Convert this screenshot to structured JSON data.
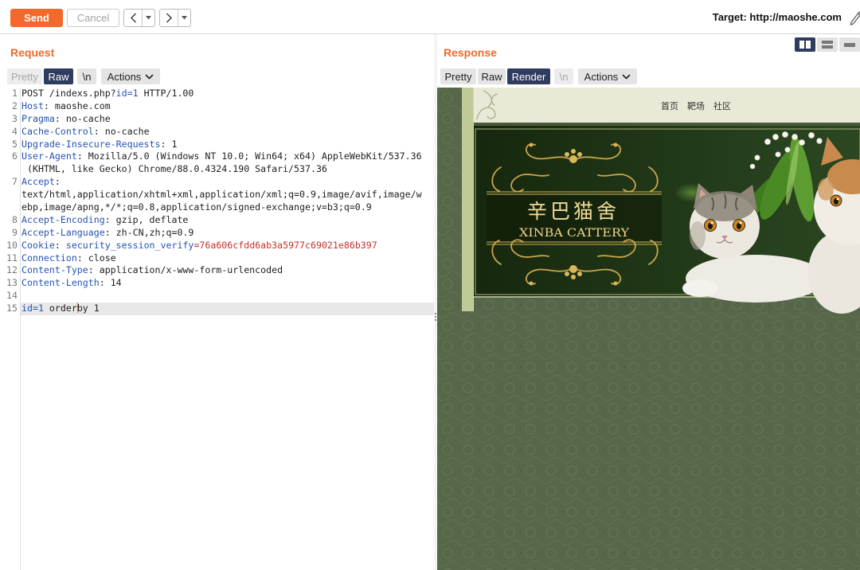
{
  "colors": {
    "accent": "#f2692b",
    "selected_tab": "#2f3b5f",
    "header_name": "#2653b3",
    "cookie_value": "#c4312a",
    "caret": "#e8732c",
    "render_bg": "#566848"
  },
  "toolbar": {
    "send_label": "Send",
    "cancel_label": "Cancel",
    "back_icon": "chevron-left-icon",
    "forward_icon": "chevron-right-icon",
    "history_menu_icon": "caret-down-icon",
    "target": "Target: http://maoshe.com",
    "edit_icon": "pencil-icon"
  },
  "request": {
    "title": "Request",
    "tabs": [
      {
        "label": "Pretty",
        "disabled": true
      },
      {
        "label": "Raw",
        "selected": true
      },
      {
        "label": "\\n"
      }
    ],
    "actions_label": "Actions",
    "actions_icon": "chevron-down-icon",
    "lines": [
      {
        "n": "1",
        "rows": [
          [
            {
              "text": "POST /indexs.php?"
            },
            {
              "key": "id=1"
            },
            {
              "text": " HTTP/1.00"
            }
          ]
        ]
      },
      {
        "n": "2",
        "rows": [
          [
            {
              "key": "Host"
            },
            {
              "text": ": maoshe.com"
            }
          ]
        ]
      },
      {
        "n": "3",
        "rows": [
          [
            {
              "key": "Pragma"
            },
            {
              "text": ": no-cache"
            }
          ]
        ]
      },
      {
        "n": "4",
        "rows": [
          [
            {
              "key": "Cache-Control"
            },
            {
              "text": ": no-cache"
            }
          ]
        ]
      },
      {
        "n": "5",
        "rows": [
          [
            {
              "key": "Upgrade-Insecure-Requests"
            },
            {
              "text": ": 1"
            }
          ]
        ]
      },
      {
        "n": "6",
        "rows": [
          [
            {
              "key": "User-Agent"
            },
            {
              "text": ": Mozilla/5.0 (Windows NT 10.0; Win64; x64) AppleWebKit/537.36"
            }
          ],
          [
            {
              "text": " (KHTML, like Gecko) Chrome/88.0.4324.190 Safari/537.36"
            }
          ]
        ]
      },
      {
        "n": "7",
        "rows": [
          [
            {
              "key": "Accept"
            },
            {
              "text": ":"
            }
          ],
          [
            {
              "text": "text/html,application/xhtml+xml,application/xml;q=0.9,image/avif,image/w"
            }
          ],
          [
            {
              "text": "ebp,image/apng,*/*;q=0.8,application/signed-exchange;v=b3;q=0.9"
            }
          ]
        ]
      },
      {
        "n": "8",
        "rows": [
          [
            {
              "key": "Accept-Encoding"
            },
            {
              "text": ": gzip, deflate"
            }
          ]
        ]
      },
      {
        "n": "9",
        "rows": [
          [
            {
              "key": "Accept-Language"
            },
            {
              "text": ": zh-CN,zh;q=0.9"
            }
          ]
        ]
      },
      {
        "n": "10",
        "rows": [
          [
            {
              "key": "Cookie"
            },
            {
              "text": ": "
            },
            {
              "key": "security_session_verify"
            },
            {
              "value": "=76a606cfdd6ab3a5977c69021e86b397"
            }
          ]
        ]
      },
      {
        "n": "11",
        "rows": [
          [
            {
              "key": "Connection"
            },
            {
              "text": ": close"
            }
          ]
        ]
      },
      {
        "n": "12",
        "rows": [
          [
            {
              "key": "Content-Type"
            },
            {
              "text": ": application/x-www-form-urlencoded"
            }
          ]
        ]
      },
      {
        "n": "13",
        "rows": [
          [
            {
              "key": "Content-Length"
            },
            {
              "text": ": 14"
            }
          ]
        ]
      },
      {
        "n": "14",
        "rows": [
          []
        ]
      },
      {
        "n": "15",
        "highlight": true,
        "rows": [
          [
            {
              "key": "id=1"
            },
            {
              "text": " order"
            },
            {
              "caret": true
            },
            {
              "text": "by 1"
            }
          ]
        ]
      }
    ]
  },
  "response": {
    "title": "Response",
    "view_toggles": [
      {
        "icon": "side-by-side-icon",
        "selected": true
      },
      {
        "icon": "top-bottom-icon"
      },
      {
        "icon": "tabs-icon"
      }
    ],
    "tabs": [
      {
        "label": "Pretty"
      },
      {
        "label": "Raw"
      },
      {
        "label": "Render",
        "selected": true
      },
      {
        "label": "\\n",
        "disabled": true
      }
    ],
    "actions_label": "Actions",
    "actions_icon": "chevron-down-icon",
    "render": {
      "nav": [
        "首页",
        "靶场",
        "社区"
      ],
      "logo_cn": "辛巴猫舍",
      "logo_en": "XINBA CATTERY"
    }
  },
  "splitter_icon": "splitter-grip-icon"
}
